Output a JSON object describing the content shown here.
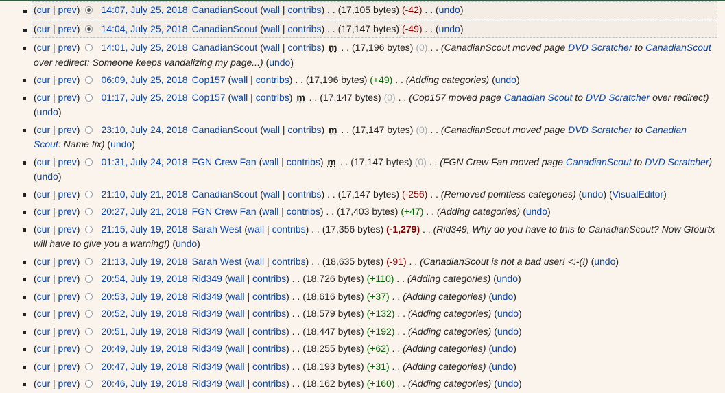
{
  "labels": {
    "cur": "cur",
    "prev": "prev",
    "wall": "wall",
    "contribs": "contribs",
    "undo": "undo",
    "minor": "m",
    "visual_editor": "VisualEditor"
  },
  "colors": {
    "positive": "#006400",
    "negative": "#8b0000",
    "neutral": "#a2a9b1",
    "link": "#0645ad"
  },
  "revisions": [
    {
      "date": "14:07, July 25, 2018",
      "user": "CanadianScout",
      "minor": false,
      "bytes": "(17,105 bytes)",
      "diff": "(-42)",
      "diff_type": "neg",
      "summary": [],
      "undo": true,
      "selected": true,
      "radio_on": true
    },
    {
      "date": "14:04, July 25, 2018",
      "user": "CanadianScout",
      "minor": false,
      "bytes": "(17,147 bytes)",
      "diff": "(-49)",
      "diff_type": "neg",
      "summary": [],
      "undo": true,
      "selected": true,
      "radio_on": true
    },
    {
      "date": "14:01, July 25, 2018",
      "user": "CanadianScout",
      "minor": true,
      "bytes": "(17,196 bytes)",
      "diff": "(0)",
      "diff_type": "zero",
      "summary": [
        {
          "t": "CanadianScout moved page "
        },
        {
          "t": "DVD Scratcher",
          "link": true
        },
        {
          "t": " to "
        },
        {
          "t": "CanadianScout",
          "link": true
        },
        {
          "t": " over redirect: Someone keeps vandalizing my page..."
        }
      ],
      "undo": true
    },
    {
      "date": "06:09, July 25, 2018",
      "user": "Cop157",
      "minor": false,
      "bytes": "(17,196 bytes)",
      "diff": "(+49)",
      "diff_type": "pos",
      "summary": [
        {
          "t": "Adding categories"
        }
      ],
      "undo": true
    },
    {
      "date": "01:17, July 25, 2018",
      "user": "Cop157",
      "minor": true,
      "bytes": "(17,147 bytes)",
      "diff": "(0)",
      "diff_type": "zero",
      "summary": [
        {
          "t": "Cop157 moved page "
        },
        {
          "t": "Canadian Scout",
          "link": true
        },
        {
          "t": " to "
        },
        {
          "t": "DVD Scratcher",
          "link": true
        },
        {
          "t": " over redirect"
        }
      ],
      "undo": true
    },
    {
      "date": "23:10, July 24, 2018",
      "user": "CanadianScout",
      "minor": true,
      "bytes": "(17,147 bytes)",
      "diff": "(0)",
      "diff_type": "zero",
      "summary": [
        {
          "t": "CanadianScout moved page "
        },
        {
          "t": "DVD Scratcher",
          "link": true
        },
        {
          "t": " to "
        },
        {
          "t": "Canadian Scout",
          "link": true
        },
        {
          "t": ": Name fix"
        }
      ],
      "undo": true
    },
    {
      "date": "01:31, July 24, 2018",
      "user": "FGN Crew Fan",
      "minor": true,
      "bytes": "(17,147 bytes)",
      "diff": "(0)",
      "diff_type": "zero",
      "summary": [
        {
          "t": "FGN Crew Fan moved page "
        },
        {
          "t": "CanadianScout",
          "link": true
        },
        {
          "t": " to "
        },
        {
          "t": "DVD Scratcher",
          "link": true
        }
      ],
      "undo": true
    },
    {
      "date": "21:10, July 21, 2018",
      "user": "CanadianScout",
      "minor": false,
      "bytes": "(17,147 bytes)",
      "diff": "(-256)",
      "diff_type": "neg",
      "summary": [
        {
          "t": "Removed pointless categories"
        }
      ],
      "undo": true,
      "visual_editor": true
    },
    {
      "date": "20:27, July 21, 2018",
      "user": "FGN Crew Fan",
      "minor": false,
      "bytes": "(17,403 bytes)",
      "diff": "(+47)",
      "diff_type": "pos",
      "summary": [
        {
          "t": "Adding categories"
        }
      ],
      "undo": true
    },
    {
      "date": "21:15, July 19, 2018",
      "user": "Sarah West",
      "minor": false,
      "bytes": "(17,356 bytes)",
      "diff": "(-1,279)",
      "diff_type": "big",
      "summary": [
        {
          "t": "Rid349, Why do you have to this to CanadianScout? Now Gfourtx will have to give you a warning!"
        }
      ],
      "undo": true
    },
    {
      "date": "21:13, July 19, 2018",
      "user": "Sarah West",
      "minor": false,
      "bytes": "(18,635 bytes)",
      "diff": "(-91)",
      "diff_type": "neg",
      "summary": [
        {
          "t": "CanadianScout is not a bad user! <:-(!"
        }
      ],
      "undo": true
    },
    {
      "date": "20:54, July 19, 2018",
      "user": "Rid349",
      "minor": false,
      "bytes": "(18,726 bytes)",
      "diff": "(+110)",
      "diff_type": "pos",
      "summary": [
        {
          "t": "Adding categories"
        }
      ],
      "undo": true
    },
    {
      "date": "20:53, July 19, 2018",
      "user": "Rid349",
      "minor": false,
      "bytes": "(18,616 bytes)",
      "diff": "(+37)",
      "diff_type": "pos",
      "summary": [
        {
          "t": "Adding categories"
        }
      ],
      "undo": true
    },
    {
      "date": "20:52, July 19, 2018",
      "user": "Rid349",
      "minor": false,
      "bytes": "(18,579 bytes)",
      "diff": "(+132)",
      "diff_type": "pos",
      "summary": [
        {
          "t": "Adding categories"
        }
      ],
      "undo": true
    },
    {
      "date": "20:51, July 19, 2018",
      "user": "Rid349",
      "minor": false,
      "bytes": "(18,447 bytes)",
      "diff": "(+192)",
      "diff_type": "pos",
      "summary": [
        {
          "t": "Adding categories"
        }
      ],
      "undo": true
    },
    {
      "date": "20:49, July 19, 2018",
      "user": "Rid349",
      "minor": false,
      "bytes": "(18,255 bytes)",
      "diff": "(+62)",
      "diff_type": "pos",
      "summary": [
        {
          "t": "Adding categories"
        }
      ],
      "undo": true
    },
    {
      "date": "20:47, July 19, 2018",
      "user": "Rid349",
      "minor": false,
      "bytes": "(18,193 bytes)",
      "diff": "(+31)",
      "diff_type": "pos",
      "summary": [
        {
          "t": "Adding categories"
        }
      ],
      "undo": true
    },
    {
      "date": "20:46, July 19, 2018",
      "user": "Rid349",
      "minor": false,
      "bytes": "(18,162 bytes)",
      "diff": "(+160)",
      "diff_type": "pos",
      "summary": [
        {
          "t": "Adding categories"
        }
      ],
      "undo": true
    }
  ]
}
